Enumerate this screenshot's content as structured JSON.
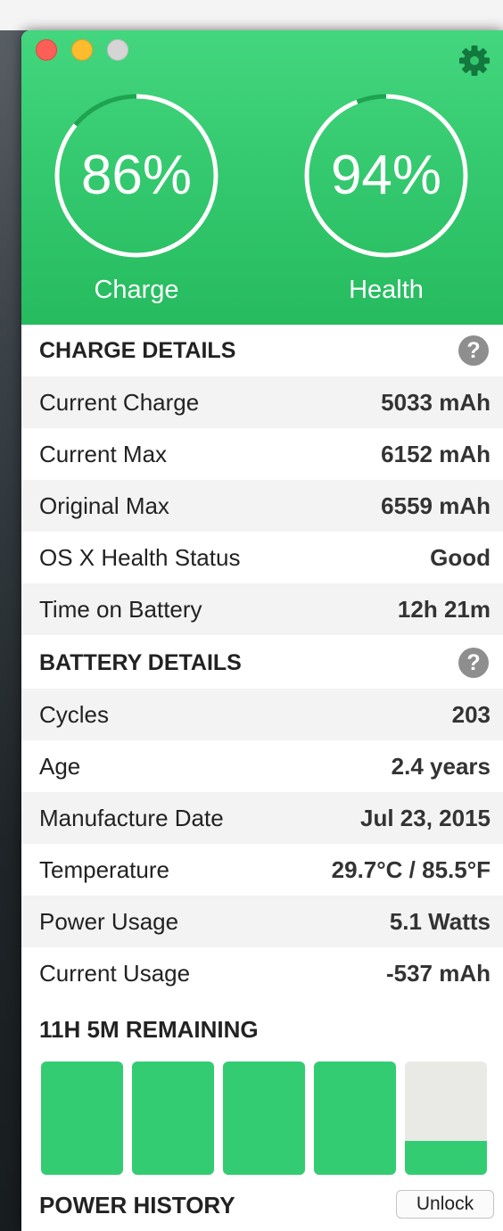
{
  "header": {
    "charge": {
      "percent": 86,
      "value_text": "86%",
      "label": "Charge"
    },
    "health": {
      "percent": 94,
      "value_text": "94%",
      "label": "Health"
    },
    "icons": {
      "settings": "gear-icon"
    }
  },
  "charge_details": {
    "title": "CHARGE DETAILS",
    "help_symbol": "?",
    "rows": [
      {
        "label": "Current Charge",
        "value": "5033 mAh"
      },
      {
        "label": "Current Max",
        "value": "6152 mAh"
      },
      {
        "label": "Original Max",
        "value": "6559 mAh"
      },
      {
        "label": "OS X Health Status",
        "value": "Good"
      },
      {
        "label": "Time on Battery",
        "value": "12h 21m"
      }
    ]
  },
  "battery_details": {
    "title": "BATTERY DETAILS",
    "help_symbol": "?",
    "rows": [
      {
        "label": "Cycles",
        "value": "203"
      },
      {
        "label": "Age",
        "value": "2.4 years"
      },
      {
        "label": "Manufacture Date",
        "value": "Jul 23, 2015"
      },
      {
        "label": "Temperature",
        "value": "29.7°C / 85.5°F"
      },
      {
        "label": "Power Usage",
        "value": "5.1 Watts"
      },
      {
        "label": "Current Usage",
        "value": "-537 mAh"
      }
    ]
  },
  "remaining": {
    "text": "11H 5M REMAINING",
    "cells": [
      1,
      1,
      1,
      1,
      0.3
    ]
  },
  "footer": {
    "power_history": "POWER HISTORY",
    "unlock_label": "Unlock"
  },
  "colors": {
    "header_top": "#43d67e",
    "header_bottom": "#25bb5e",
    "accent_green": "#33cc72",
    "empty_cell": "#e9e9e6",
    "help_icon": "#8e8e8e"
  }
}
